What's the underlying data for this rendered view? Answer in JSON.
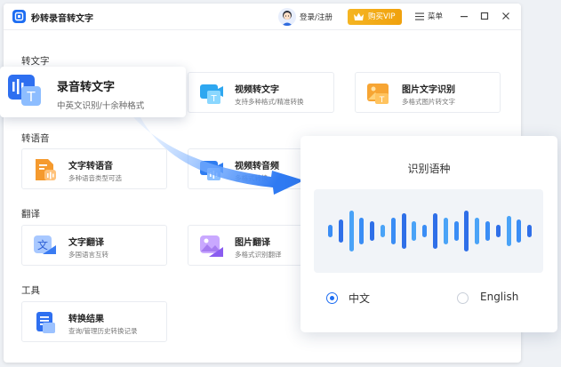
{
  "app": {
    "title": "秒转录音转文字"
  },
  "header": {
    "login_label": "登录/注册",
    "vip_label": "购买VIP",
    "menu_label": "菜单"
  },
  "sections": {
    "to_text": "转文字",
    "to_speech": "转语音",
    "translate": "翻译",
    "tools": "工具"
  },
  "cards": {
    "audio_to_text": {
      "title": "录音转文字",
      "desc": "中英文识别/十余种格式"
    },
    "video_to_text": {
      "title": "视频转文字",
      "desc": "支持多种格式/精准转换"
    },
    "image_text_ocr": {
      "title": "图片文字识别",
      "desc": "多格式图片转文字"
    },
    "text_to_speech": {
      "title": "文字转语音",
      "desc": "多种语音类型可选"
    },
    "video_to_audio": {
      "title": "视频转音频",
      "desc": "多格式转换"
    },
    "text_translate": {
      "title": "文字翻译",
      "desc": "多国语言互转"
    },
    "image_translate": {
      "title": "图片翻译",
      "desc": "多格式识别翻译"
    },
    "convert_results": {
      "title": "转换结果",
      "desc": "查询/管理历史转换记录"
    }
  },
  "language_panel": {
    "title": "识别语种",
    "options": [
      {
        "label": "中文",
        "selected": true
      },
      {
        "label": "English",
        "selected": false
      }
    ]
  },
  "colors": {
    "brand_blue": "#1d6df2",
    "vip_gold": "#f5b523",
    "orange": "#f59a2e"
  }
}
